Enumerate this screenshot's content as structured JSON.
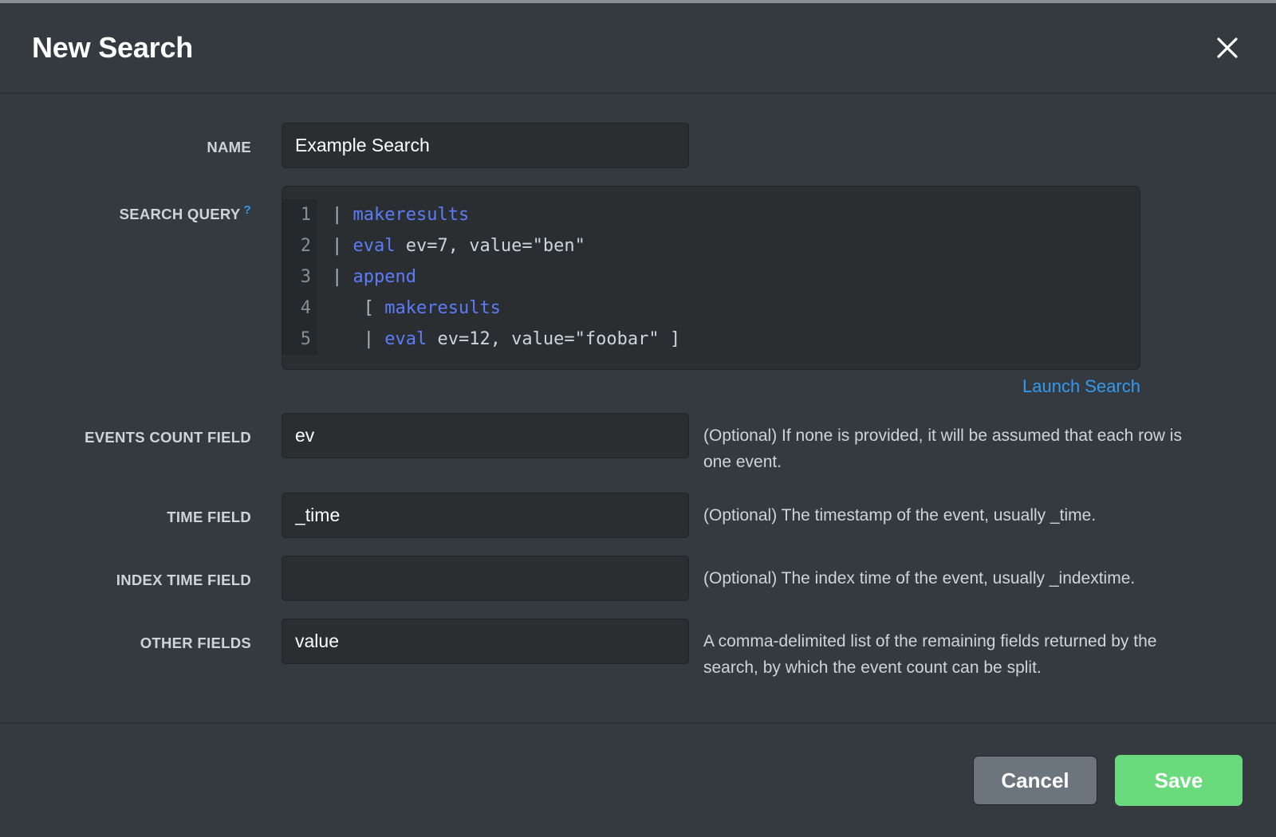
{
  "header": {
    "title": "New Search",
    "close_icon": "close-icon"
  },
  "form": {
    "name": {
      "label": "NAME",
      "value": "Example Search",
      "placeholder": ""
    },
    "search_query": {
      "label": "SEARCH QUERY",
      "help_marker": "?",
      "lines": [
        {
          "number": "1",
          "pipe": "| ",
          "command": "makeresults",
          "rest": ""
        },
        {
          "number": "2",
          "pipe": "| ",
          "command": "eval",
          "rest": " ev=7, value=\"ben\""
        },
        {
          "number": "3",
          "pipe": "| ",
          "command": "append",
          "rest": ""
        },
        {
          "number": "4",
          "pipe": "   [ ",
          "command": "makeresults",
          "rest": ""
        },
        {
          "number": "5",
          "pipe": "   | ",
          "command": "eval",
          "rest": " ev=12, value=\"foobar\" ]"
        }
      ],
      "launch_link": "Launch Search"
    },
    "events_count_field": {
      "label": "EVENTS COUNT FIELD",
      "value": "ev",
      "placeholder": "",
      "help": "(Optional) If none is provided, it will be assumed that each row is one event."
    },
    "time_field": {
      "label": "TIME FIELD",
      "value": "_time",
      "placeholder": "",
      "help": "(Optional) The timestamp of the event, usually _time."
    },
    "index_time_field": {
      "label": "INDEX TIME FIELD",
      "value": "",
      "placeholder": "",
      "help": "(Optional) The index time of the event, usually _indextime."
    },
    "other_fields": {
      "label": "OTHER FIELDS",
      "value": "value",
      "placeholder": "",
      "help": "A comma-delimited list of the remaining fields returned by the search, by which the event count can be split."
    }
  },
  "footer": {
    "cancel_label": "Cancel",
    "save_label": "Save"
  },
  "colors": {
    "page_background": "#343a40",
    "input_background": "#2b2e31",
    "gutter_background": "#26292c",
    "accent_link": "#339af0",
    "code_command": "#5c7cfa",
    "save_button": "#69db7c",
    "cancel_button": "#6c757d",
    "top_strip": "#868e96"
  }
}
